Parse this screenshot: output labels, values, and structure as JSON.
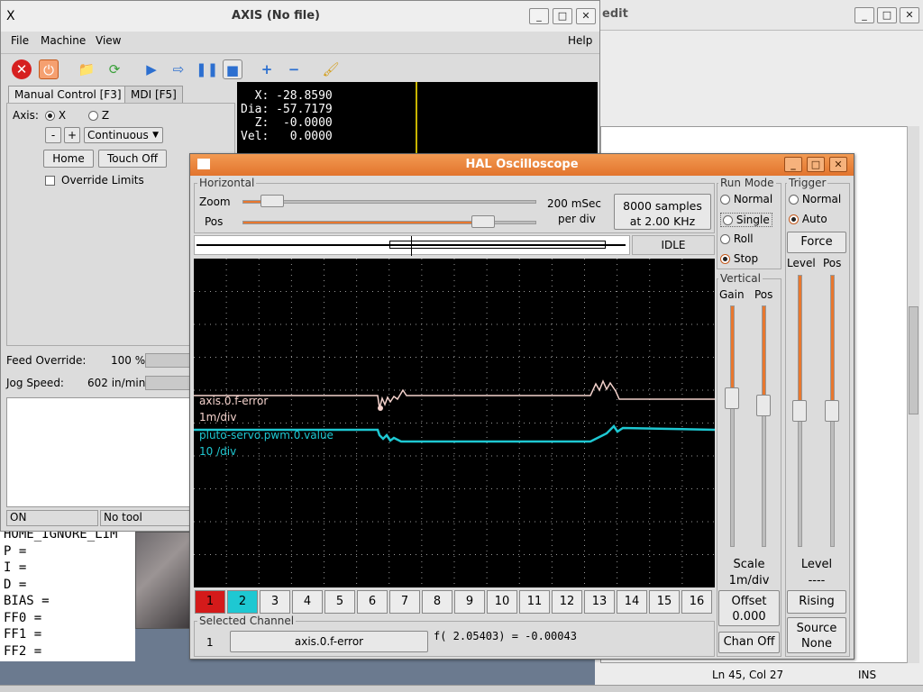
{
  "editor": {
    "title": "edit",
    "status_position": "Ln 45, Col 27",
    "status_mode": "INS"
  },
  "halcfg": {
    "lines": [
      "HOME_IGNORE_LIM",
      "P =",
      "I =",
      "D =",
      "BIAS =",
      "FF0 =",
      "FF1 =",
      "FF2 ="
    ]
  },
  "axis": {
    "title": "AXIS (No file)",
    "menu": {
      "file": "File",
      "machine": "Machine",
      "view": "View",
      "help": "Help"
    },
    "tabs": {
      "manual": "Manual Control [F3]",
      "mdi": "MDI [F5]"
    },
    "axis_label": "Axis:",
    "axis_x": "X",
    "axis_z": "Z",
    "jog_minus": "-",
    "jog_plus": "+",
    "jog_mode": "Continuous",
    "home": "Home",
    "touch_off": "Touch Off",
    "override_limits": "Override Limits",
    "dro": {
      "x": "  X: -28.8590",
      "dia": "Dia: -57.7179",
      "z": "  Z:  -0.0000",
      "vel": "Vel:   0.0000"
    },
    "feed_override_label": "Feed Override:",
    "feed_override_value": "100 %",
    "jog_speed_label": "Jog Speed:",
    "jog_speed_value": "602 in/min",
    "status_state": "ON",
    "status_tool": "No tool"
  },
  "scope": {
    "title": "HAL Oscilloscope",
    "horizontal": "Horizontal",
    "zoom": "Zoom",
    "pos": "Pos",
    "zoom_fraction": 0.1,
    "pos_fraction": 0.82,
    "time_div_1": "200 mSec",
    "time_div_2": "per div",
    "samples_1": "8000 samples",
    "samples_2": "at 2.00 KHz",
    "state": "IDLE",
    "run_mode": "Run Mode",
    "normal": "Normal",
    "single": "Single",
    "roll": "Roll",
    "stop": "Stop",
    "trigger": "Trigger",
    "trig_normal": "Normal",
    "trig_auto": "Auto",
    "force": "Force",
    "level": "Level",
    "tpos": "Pos",
    "vertical": "Vertical",
    "gain": "Gain",
    "vpos": "Pos",
    "scale": "Scale",
    "scale_value": "1m/div",
    "level_label": "Level",
    "level_value": "----",
    "offset": "Offset",
    "offset_value": "0.000",
    "rising": "Rising",
    "source": "Source",
    "source_value": "None",
    "chan_off": "Chan Off",
    "selected_channel": "Selected Channel",
    "sel_num": "1",
    "sel_name": "axis.0.f-error",
    "readout": "f( 2.05403) = -0.00043",
    "ch1_name": "axis.0.f-error",
    "ch1_scale": "1m/div",
    "ch2_name": "pluto-servo.pwm.0.value",
    "ch2_scale": "10 /div",
    "channels": [
      "1",
      "2",
      "3",
      "4",
      "5",
      "6",
      "7",
      "8",
      "9",
      "10",
      "11",
      "12",
      "13",
      "14",
      "15",
      "16"
    ],
    "colors": {
      "ch1": "#f4d2cc",
      "ch2": "#1ec8d2",
      "accent": "#e8772e"
    }
  }
}
